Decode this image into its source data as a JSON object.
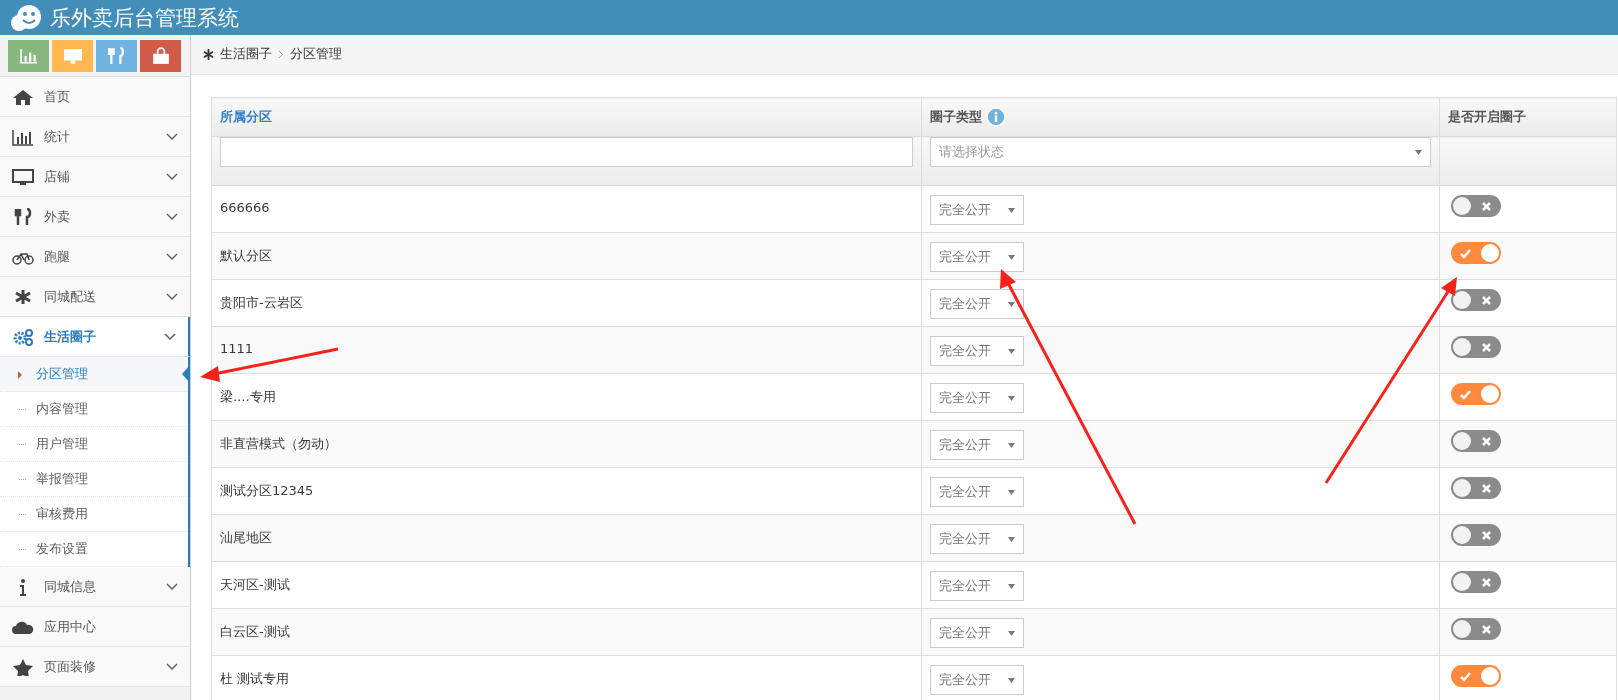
{
  "header": {
    "title": "乐外卖后台管理系统"
  },
  "shortcuts": [
    {
      "color": "#87b87f"
    },
    {
      "color": "#ffb752"
    },
    {
      "color": "#6fb3e0"
    },
    {
      "color": "#d15b47"
    }
  ],
  "sidebar": {
    "items": [
      {
        "label": "首页",
        "submenu": false,
        "selected": false
      },
      {
        "label": "统计",
        "submenu": true,
        "selected": false
      },
      {
        "label": "店铺",
        "submenu": true,
        "selected": false
      },
      {
        "label": "外卖",
        "submenu": true,
        "selected": false
      },
      {
        "label": "跑腿",
        "submenu": true,
        "selected": false
      },
      {
        "label": "同城配送",
        "submenu": true,
        "selected": false
      },
      {
        "label": "生活圈子",
        "submenu": true,
        "selected": true,
        "children": [
          {
            "label": "分区管理",
            "selected": true
          },
          {
            "label": "内容管理",
            "selected": false
          },
          {
            "label": "用户管理",
            "selected": false
          },
          {
            "label": "举报管理",
            "selected": false
          },
          {
            "label": "审核费用",
            "selected": false
          },
          {
            "label": "发布设置",
            "selected": false
          }
        ]
      },
      {
        "label": "同城信息",
        "submenu": true,
        "selected": false
      },
      {
        "label": "应用中心",
        "submenu": false,
        "selected": false
      },
      {
        "label": "页面装修",
        "submenu": true,
        "selected": false
      }
    ]
  },
  "breadcrumb": [
    "生活圈子",
    "分区管理"
  ],
  "table": {
    "columns": [
      {
        "label": "所属分区"
      },
      {
        "label": "圈子类型"
      },
      {
        "label": "是否开启圈子"
      }
    ],
    "filters": {
      "type_placeholder": "请选择状态"
    },
    "rows": [
      {
        "name": "666666",
        "type": "完全公开",
        "on": false
      },
      {
        "name": "默认分区",
        "type": "完全公开",
        "on": true
      },
      {
        "name": "贵阳市-云岩区",
        "type": "完全公开",
        "on": false
      },
      {
        "name": "1111",
        "type": "完全公开",
        "on": false
      },
      {
        "name": "梁....专用",
        "type": "完全公开",
        "on": true
      },
      {
        "name": "非直营模式（勿动）",
        "type": "完全公开",
        "on": false
      },
      {
        "name": "测试分区12345",
        "type": "完全公开",
        "on": false
      },
      {
        "name": "汕尾地区",
        "type": "完全公开",
        "on": false
      },
      {
        "name": "天河区-测试",
        "type": "完全公开",
        "on": false
      },
      {
        "name": "白云区-测试",
        "type": "完全公开",
        "on": false
      },
      {
        "name": "杜 测试专用",
        "type": "完全公开",
        "on": true
      }
    ]
  }
}
